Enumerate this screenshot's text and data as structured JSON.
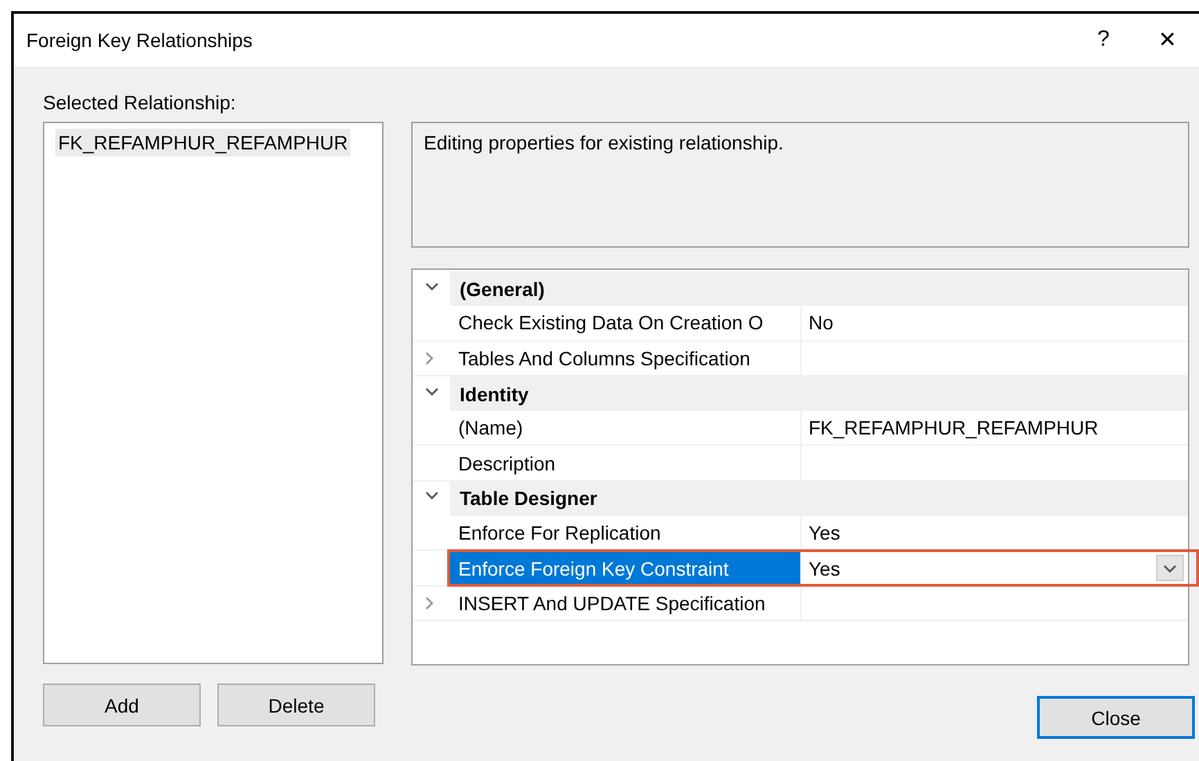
{
  "window": {
    "title": "Foreign Key Relationships",
    "help": "?",
    "close": "✕"
  },
  "relationships": {
    "label": "Selected Relationship:",
    "items": [
      {
        "name": "FK_REFAMPHUR_REFAMPHUR",
        "selected": true
      }
    ]
  },
  "description": "Editing properties for existing relationship.",
  "properties": [
    {
      "kind": "category",
      "name": "(General)",
      "expanded": true
    },
    {
      "kind": "property",
      "name": "Check Existing Data On Creation O",
      "value": "No",
      "expandable": false,
      "selected": false,
      "highlighted": false
    },
    {
      "kind": "property",
      "name": "Tables And Columns Specification",
      "expandable": true,
      "selected": false,
      "highlighted": false
    },
    {
      "kind": "category",
      "name": "Identity",
      "expanded": true
    },
    {
      "kind": "property",
      "name": "(Name)",
      "value": "FK_REFAMPHUR_REFAMPHUR",
      "expandable": false,
      "selected": false,
      "highlighted": false
    },
    {
      "kind": "property",
      "name": "Description",
      "expandable": false,
      "selected": false,
      "highlighted": false
    },
    {
      "kind": "category",
      "name": "Table Designer",
      "expanded": true
    },
    {
      "kind": "property",
      "name": "Enforce For Replication",
      "value": "Yes",
      "expandable": false,
      "selected": false,
      "highlighted": false
    },
    {
      "kind": "property",
      "name": "Enforce Foreign Key Constraint",
      "value": "Yes",
      "expandable": false,
      "selected": true,
      "highlighted": true
    },
    {
      "kind": "property",
      "name": "INSERT And UPDATE Specification",
      "expandable": true,
      "selected": false,
      "highlighted": false
    }
  ],
  "buttons": {
    "add": "Add",
    "delete": "Delete",
    "close": "Close"
  }
}
